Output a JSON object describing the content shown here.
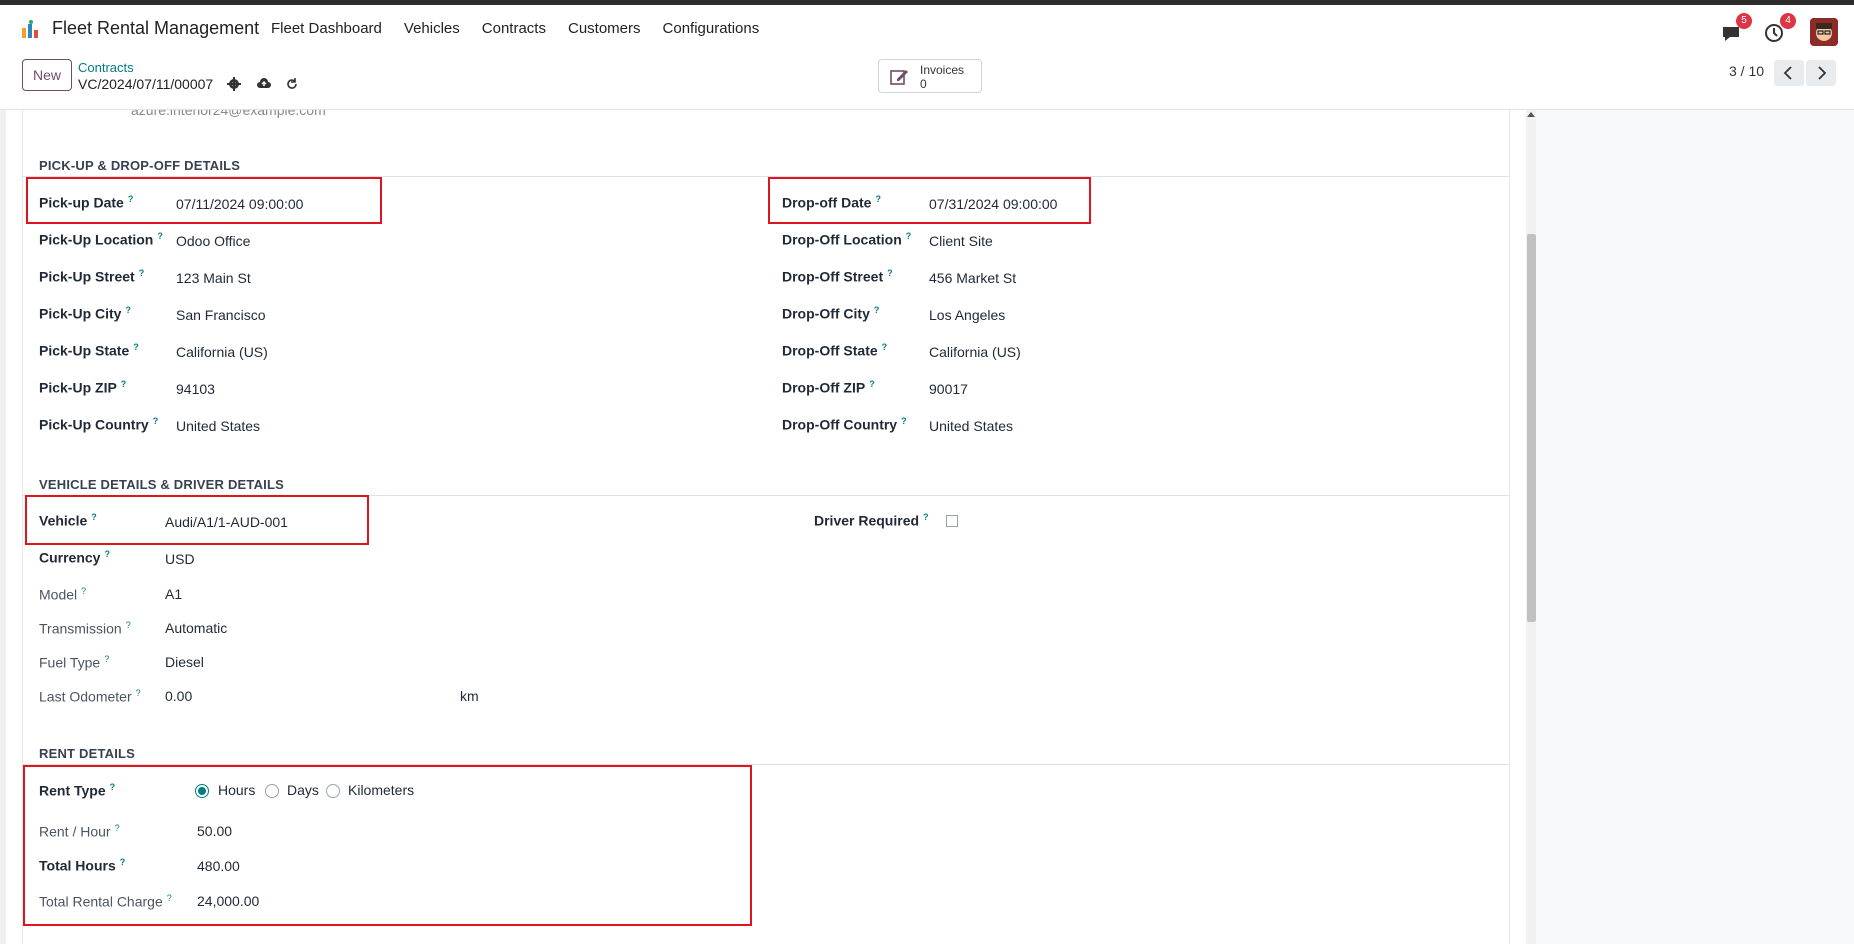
{
  "app": {
    "title": "Fleet Rental Management",
    "menu": [
      "Fleet Dashboard",
      "Vehicles",
      "Contracts",
      "Customers",
      "Configurations"
    ],
    "messages_badge": "5",
    "activities_badge": "4"
  },
  "control": {
    "new_label": "New",
    "breadcrumb": "Contracts",
    "record_name": "VC/2024/07/11/00007",
    "invoices_label": "Invoices",
    "invoices_count": "0",
    "pager": "3 / 10"
  },
  "form": {
    "cut_off_value": "azure.interior24@example.com",
    "pickup_section": {
      "title": "PICK-UP & DROP-OFF DETAILS",
      "left": [
        {
          "label": "Pick-up Date",
          "value": "07/11/2024 09:00:00"
        },
        {
          "label": "Pick-Up Location",
          "value": "Odoo Office"
        },
        {
          "label": "Pick-Up Street",
          "value": "123 Main St"
        },
        {
          "label": "Pick-Up City",
          "value": "San Francisco"
        },
        {
          "label": "Pick-Up State",
          "value": "California (US)"
        },
        {
          "label": "Pick-Up ZIP",
          "value": "94103"
        },
        {
          "label": "Pick-Up Country",
          "value": "United States"
        }
      ],
      "right": [
        {
          "label": "Drop-off Date",
          "value": "07/31/2024 09:00:00"
        },
        {
          "label": "Drop-Off Location",
          "value": "Client Site"
        },
        {
          "label": "Drop-Off Street",
          "value": "456 Market St"
        },
        {
          "label": "Drop-Off City",
          "value": "Los Angeles"
        },
        {
          "label": "Drop-Off State",
          "value": "California (US)"
        },
        {
          "label": "Drop-Off ZIP",
          "value": "90017"
        },
        {
          "label": "Drop-Off Country",
          "value": "United States"
        }
      ]
    },
    "vehicle_section": {
      "title": "VEHICLE DETAILS & DRIVER DETAILS",
      "vehicle": {
        "label": "Vehicle",
        "value": "Audi/A1/1-AUD-001"
      },
      "currency": {
        "label": "Currency",
        "value": "USD"
      },
      "model": {
        "label": "Model",
        "value": "A1"
      },
      "transmission": {
        "label": "Transmission",
        "value": "Automatic"
      },
      "fuel_type": {
        "label": "Fuel Type",
        "value": "Diesel"
      },
      "odometer": {
        "label": "Last Odometer",
        "value": "0.00",
        "unit": "km"
      },
      "driver_required": {
        "label": "Driver Required",
        "checked": false
      }
    },
    "rent_section": {
      "title": "RENT DETAILS",
      "rent_type_label": "Rent Type",
      "rent_type_options": [
        "Hours",
        "Days",
        "Kilometers"
      ],
      "rent_type_selected": "Hours",
      "rent_per_hour": {
        "label": "Rent / Hour",
        "value": "50.00"
      },
      "total_hours": {
        "label": "Total Hours",
        "value": "480.00"
      },
      "total_rental_charge": {
        "label": "Total Rental Charge",
        "value": "24,000.00"
      }
    }
  },
  "colors": {
    "accent": "#017e84",
    "brand": "#714b67",
    "highlight": "#e0141e"
  }
}
